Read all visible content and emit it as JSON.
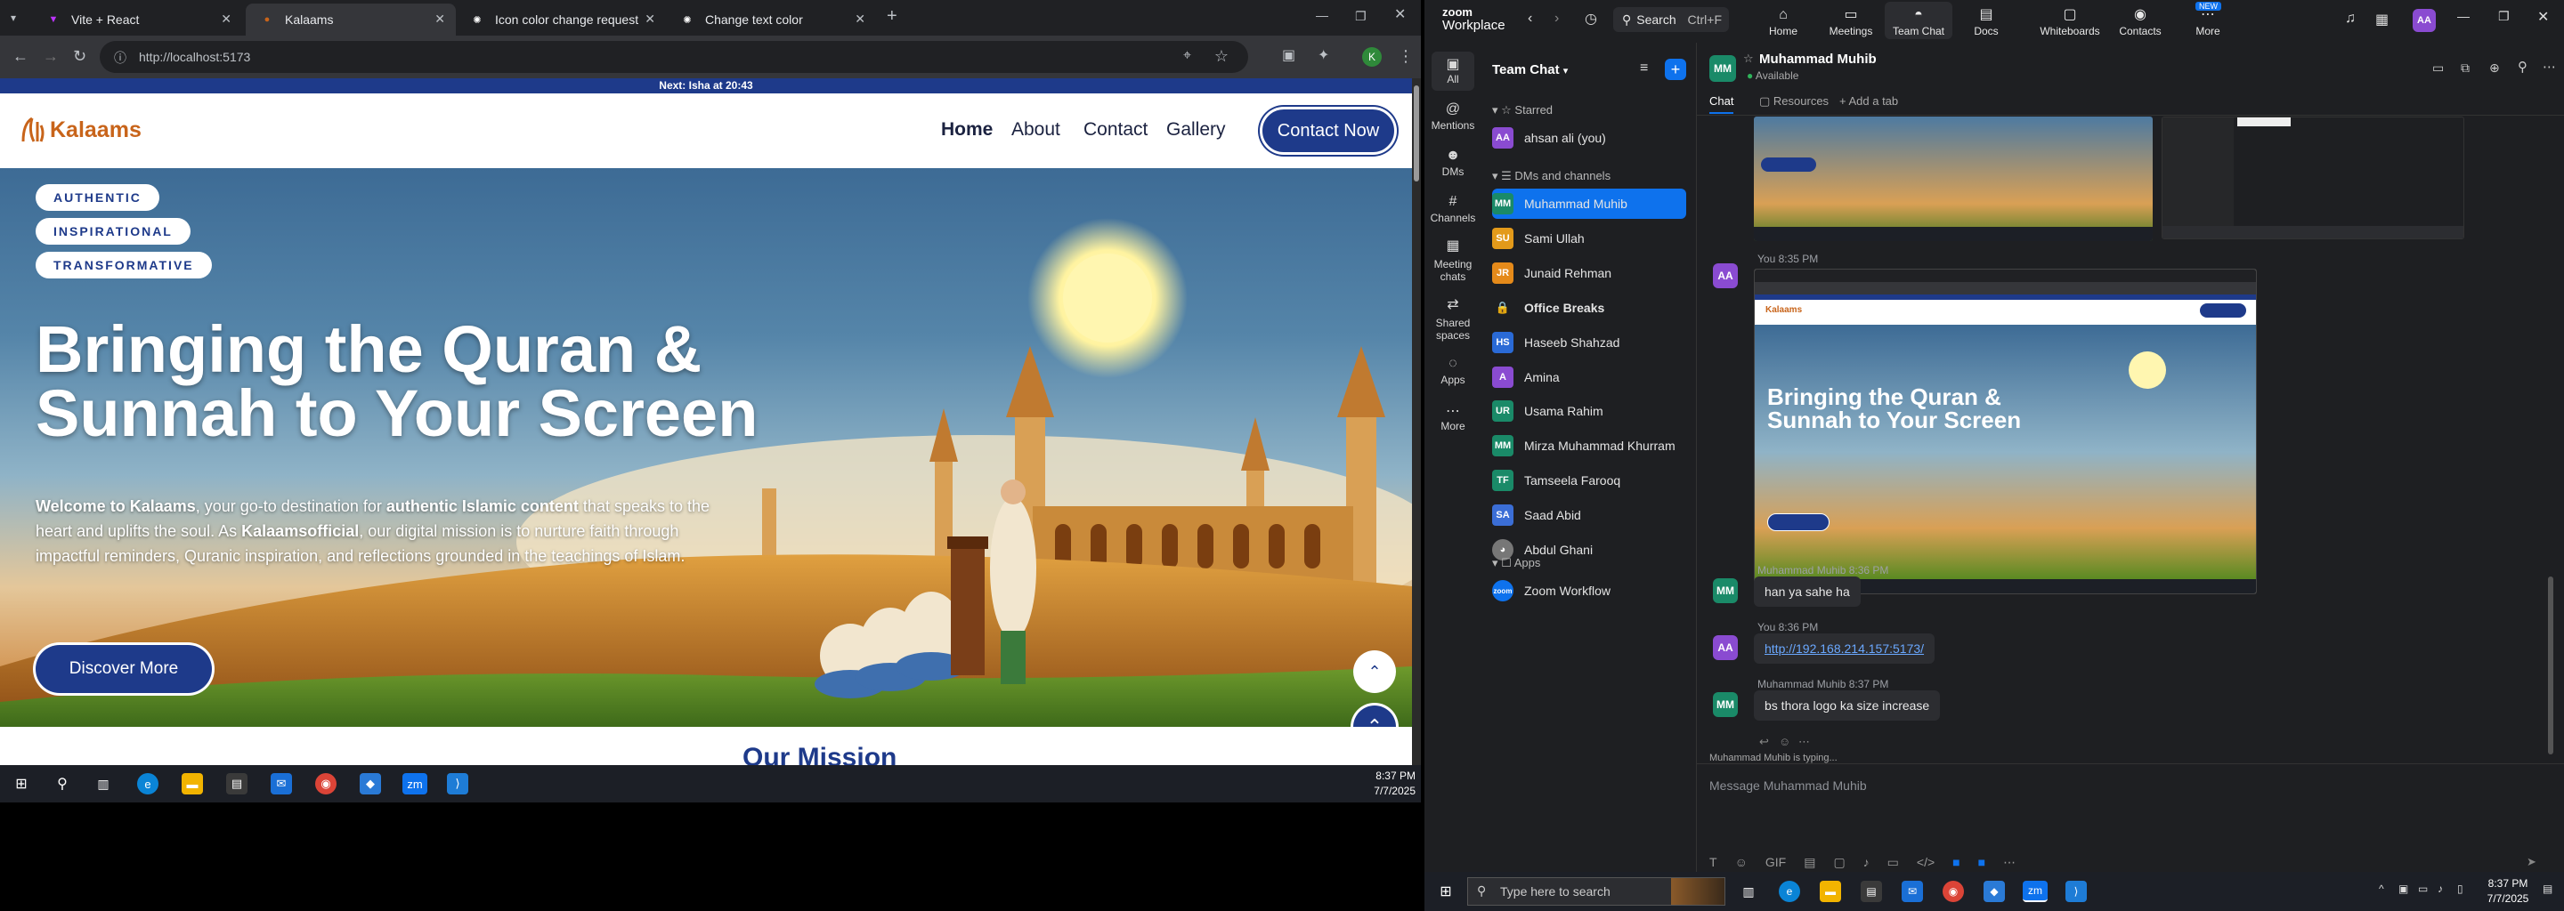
{
  "browser": {
    "tabs": [
      {
        "title": "Vite + React",
        "active": false
      },
      {
        "title": "Kalaams",
        "active": true
      },
      {
        "title": "Icon color change request",
        "active": false
      },
      {
        "title": "Change text color",
        "active": false
      }
    ],
    "url": "http://localhost:5173",
    "profile_letter": "K"
  },
  "site": {
    "prayer_bar": "Next: Isha at 20:43",
    "logo_text": "Kalaams",
    "nav": [
      "Home",
      "About",
      "Contact",
      "Gallery"
    ],
    "contact_button": "Contact Now",
    "pills": [
      "AUTHENTIC",
      "INSPIRATIONAL",
      "TRANSFORMATIVE"
    ],
    "headline_line1": "Bringing the Quran &",
    "headline_line2": "Sunnah to Your Screen",
    "intro": [
      {
        "text": "Welcome to Kalaams",
        "bold": true
      },
      {
        "text": ", your go-to destination for ",
        "bold": false
      },
      {
        "text": "authentic Islamic content",
        "bold": true
      },
      {
        "text": " that speaks to the heart and uplifts the soul. As ",
        "bold": false
      },
      {
        "text": "Kalaamsofficial",
        "bold": true
      },
      {
        "text": ", our digital mission is to nurture faith through impactful reminders, Quranic inspiration, and reflections grounded in the teachings of Islam.",
        "bold": false
      }
    ],
    "discover_button": "Discover More",
    "next_section_peek": "Our Mission"
  },
  "left_taskbar": {
    "time": "8:37 PM",
    "date": "7/7/2025"
  },
  "zoom": {
    "brand_line1": "zoom",
    "brand_line2": "Workplace",
    "search_label": "Search",
    "search_shortcut": "Ctrl+F",
    "top_tabs": [
      {
        "label": "Home",
        "icon": "home-icon",
        "glyph": "⌂"
      },
      {
        "label": "Meetings",
        "icon": "video-icon",
        "glyph": "▭"
      },
      {
        "label": "Team Chat",
        "icon": "chat-icon",
        "glyph": "◓",
        "active": true
      },
      {
        "label": "Docs",
        "icon": "docs-icon",
        "glyph": "▤"
      },
      {
        "label": "Whiteboards",
        "icon": "whiteboard-icon",
        "glyph": "▢"
      },
      {
        "label": "Contacts",
        "icon": "contacts-icon",
        "glyph": "◉"
      },
      {
        "label": "More",
        "icon": "more-icon",
        "glyph": "⋯",
        "badge": "NEW"
      }
    ],
    "user_initials": "AA",
    "rail": [
      {
        "label": "All",
        "glyph": "▣"
      },
      {
        "label": "Mentions",
        "glyph": "@"
      },
      {
        "label": "DMs",
        "glyph": "☻"
      },
      {
        "label": "Channels",
        "glyph": "#"
      },
      {
        "label": "Meeting chats",
        "glyph": "▦"
      },
      {
        "label": "Shared spaces",
        "glyph": "⇄"
      },
      {
        "label": "Apps",
        "glyph": "◌"
      },
      {
        "label": "More",
        "glyph": "⋯"
      }
    ],
    "list_title": "Team Chat",
    "sections": {
      "starred": "Starred",
      "dms": "DMs and channels",
      "apps": "Apps"
    },
    "starred": [
      {
        "name": "ahsan ali (you)",
        "initials": "AA",
        "color": "#8a4bd1"
      }
    ],
    "contacts": [
      {
        "name": "Muhammad Muhib",
        "initials": "MM",
        "color": "#1a8a68",
        "selected": true
      },
      {
        "name": "Sami Ullah",
        "initials": "SU",
        "color": "#e39a1a"
      },
      {
        "name": "Junaid Rehman",
        "initials": "JR",
        "color": "#e58a1a"
      },
      {
        "name": "Office Breaks",
        "initials": "",
        "color": "#444",
        "bold": true,
        "lock": true
      },
      {
        "name": "Haseeb Shahzad",
        "initials": "HS",
        "color": "#2a6ad6"
      },
      {
        "name": "Amina",
        "initials": "A",
        "color": "#8a4bd1"
      },
      {
        "name": "Usama Rahim",
        "initials": "UR",
        "color": "#1a8a68"
      },
      {
        "name": "Mirza Muhammad Khurram",
        "initials": "MM",
        "color": "#1a8a68"
      },
      {
        "name": "Tamseela Farooq",
        "initials": "TF",
        "color": "#1a8a68"
      },
      {
        "name": "Saad Abid",
        "initials": "SA",
        "color": "#3b6ed6"
      },
      {
        "name": "Abdul Ghani",
        "initials": "",
        "color": "#777",
        "photo": true
      }
    ],
    "apps": [
      {
        "name": "Zoom Workflow",
        "initials": "zoom",
        "color": "#0e72ed"
      }
    ],
    "chat": {
      "peer_name": "Muhammad Muhib",
      "peer_initials": "MM",
      "peer_status": "Available",
      "tabs": [
        "Chat",
        "Resources",
        "+ Add a tab"
      ],
      "messages": [
        {
          "sender": "You",
          "time": "8:35 PM",
          "initials": "AA"
        },
        {
          "sender": "Muhammad Muhib",
          "time": "8:36 PM",
          "initials": "MM",
          "text": "han ya sahe ha"
        },
        {
          "sender": "You",
          "time": "8:36 PM",
          "initials": "AA",
          "text": "http://192.168.214.157:5173/",
          "link": true
        },
        {
          "sender": "Muhammad Muhib",
          "time": "8:37 PM",
          "initials": "MM",
          "text": "bs thora logo ka size increase"
        }
      ],
      "typing": "Muhammad Muhib  is typing...",
      "composer_placeholder": "Message Muhammad Muhib"
    }
  },
  "win_taskbar": {
    "search_placeholder": "Type here to search",
    "time": "8:37 PM",
    "date": "7/7/2025"
  },
  "colors": {
    "brand_blue": "#1e3a8a",
    "zoom_blue": "#0e72ed",
    "logo_orange": "#c8641a"
  }
}
